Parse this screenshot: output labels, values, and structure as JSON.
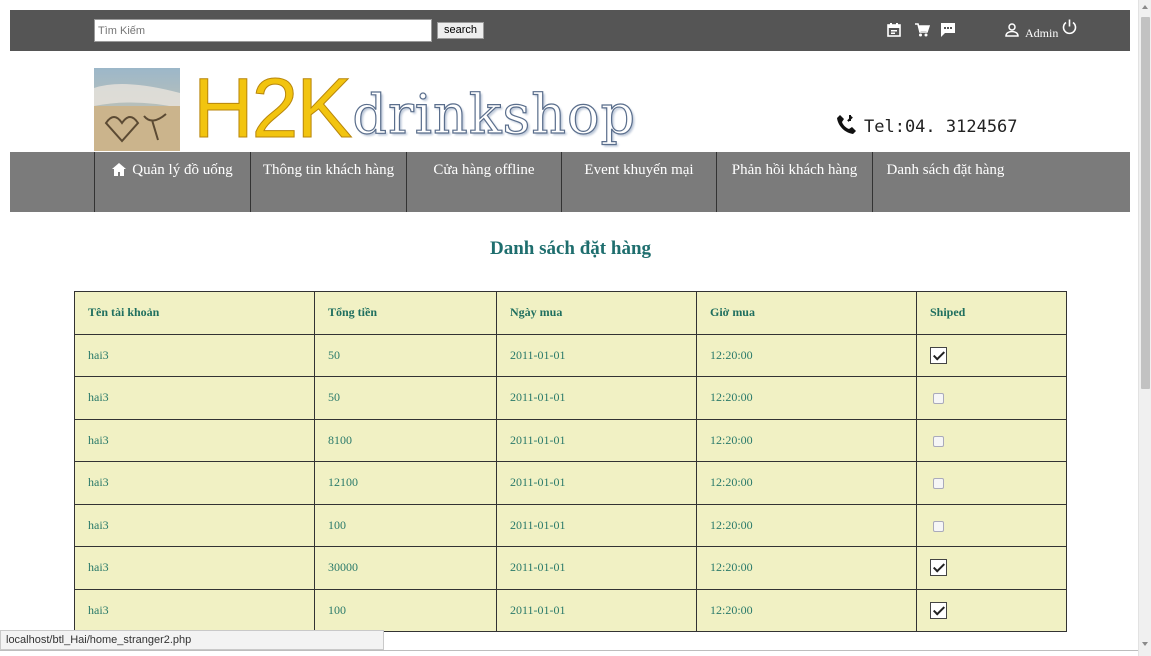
{
  "topbar": {
    "search_placeholder": "Tìm Kiếm",
    "search_button": "search",
    "admin_label": "Admin",
    "icons": [
      "calendar-icon",
      "cart-icon",
      "message-icon",
      "user-icon",
      "power-icon"
    ]
  },
  "header": {
    "logo_part1": "H2K",
    "logo_part2": "drinkshop",
    "tel": "Tel:04. 3124567"
  },
  "nav": {
    "items": [
      {
        "label": "Quản lý đồ uống"
      },
      {
        "label": "Thông tin khách hàng"
      },
      {
        "label": "Cửa hàng offline"
      },
      {
        "label": "Event khuyến mại"
      },
      {
        "label": "Phản hồi khách hàng"
      },
      {
        "label": "Danh sách đặt hàng"
      }
    ]
  },
  "main": {
    "title": "Danh sách đặt hàng",
    "table": {
      "headers": [
        "Tên tài khoản",
        "Tổng tiền",
        "Ngày mua",
        "Giờ mua",
        "Shiped"
      ],
      "rows": [
        {
          "account": "hai3",
          "total": "50",
          "date": "2011-01-01",
          "time": "12:20:00",
          "shipped": true
        },
        {
          "account": "hai3",
          "total": "50",
          "date": "2011-01-01",
          "time": "12:20:00",
          "shipped": false
        },
        {
          "account": "hai3",
          "total": "8100",
          "date": "2011-01-01",
          "time": "12:20:00",
          "shipped": false
        },
        {
          "account": "hai3",
          "total": "12100",
          "date": "2011-01-01",
          "time": "12:20:00",
          "shipped": false
        },
        {
          "account": "hai3",
          "total": "100",
          "date": "2011-01-01",
          "time": "12:20:00",
          "shipped": false
        },
        {
          "account": "hai3",
          "total": "30000",
          "date": "2011-01-01",
          "time": "12:20:00",
          "shipped": true
        },
        {
          "account": "hai3",
          "total": "100",
          "date": "2011-01-01",
          "time": "12:20:00",
          "shipped": true
        }
      ]
    }
  },
  "statusbar": {
    "url": "localhost/btl_Hai/home_stranger2.php"
  },
  "colors": {
    "topbar": "#555555",
    "nav": "#7b7b7b",
    "table_bg": "#f1f1c4",
    "title": "#1e6e6e",
    "logo_yellow": "#f2c40f"
  }
}
